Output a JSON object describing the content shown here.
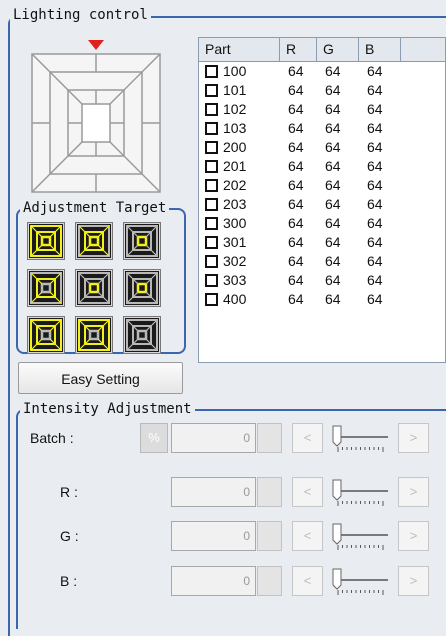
{
  "lighting_control": {
    "title": "Lighting control"
  },
  "adjustment_target": {
    "title": "Adjustment Target",
    "buttons": [
      {
        "name": "all-outer",
        "highlight": [
          1,
          1,
          1
        ]
      },
      {
        "name": "middle-inner",
        "highlight": [
          0,
          1,
          1
        ]
      },
      {
        "name": "inner",
        "highlight": [
          0,
          0,
          1
        ]
      },
      {
        "name": "left-side",
        "highlight": [
          0,
          1,
          0
        ]
      },
      {
        "name": "center",
        "highlight": [
          0,
          0,
          1
        ]
      },
      {
        "name": "right-ring",
        "highlight": [
          0,
          0,
          1
        ]
      },
      {
        "name": "bottom-left",
        "highlight": [
          1,
          1,
          0
        ]
      },
      {
        "name": "bottom-center",
        "highlight": [
          1,
          1,
          0
        ]
      },
      {
        "name": "bottom-right",
        "highlight": [
          0,
          0,
          0
        ]
      }
    ],
    "colors": {
      "on": "#f2ef1a",
      "off": "#b8b8b8",
      "bg": "#1a1a1a"
    }
  },
  "table": {
    "headers": [
      "Part",
      "R",
      "G",
      "B",
      ""
    ],
    "rows": [
      {
        "part": "100",
        "r": "64",
        "g": "64",
        "b": "64"
      },
      {
        "part": "101",
        "r": "64",
        "g": "64",
        "b": "64"
      },
      {
        "part": "102",
        "r": "64",
        "g": "64",
        "b": "64"
      },
      {
        "part": "103",
        "r": "64",
        "g": "64",
        "b": "64"
      },
      {
        "part": "200",
        "r": "64",
        "g": "64",
        "b": "64"
      },
      {
        "part": "201",
        "r": "64",
        "g": "64",
        "b": "64"
      },
      {
        "part": "202",
        "r": "64",
        "g": "64",
        "b": "64"
      },
      {
        "part": "203",
        "r": "64",
        "g": "64",
        "b": "64"
      },
      {
        "part": "300",
        "r": "64",
        "g": "64",
        "b": "64"
      },
      {
        "part": "301",
        "r": "64",
        "g": "64",
        "b": "64"
      },
      {
        "part": "302",
        "r": "64",
        "g": "64",
        "b": "64"
      },
      {
        "part": "303",
        "r": "64",
        "g": "64",
        "b": "64"
      },
      {
        "part": "400",
        "r": "64",
        "g": "64",
        "b": "64"
      }
    ]
  },
  "easy_setting": {
    "label": "Easy Setting"
  },
  "intensity": {
    "title": "Intensity Adjustment",
    "pct_label": "%",
    "left_label": "<",
    "right_label": ">",
    "rows": [
      {
        "key": "batch",
        "label": "Batch :",
        "value": "0",
        "has_pct": true
      },
      {
        "key": "r",
        "label": "R :",
        "value": "0",
        "has_pct": false
      },
      {
        "key": "g",
        "label": "G :",
        "value": "0",
        "has_pct": false
      },
      {
        "key": "b",
        "label": "B :",
        "value": "0",
        "has_pct": false
      }
    ]
  },
  "colors": {
    "accent": "#3a66b0",
    "marker": "#e0201c"
  }
}
